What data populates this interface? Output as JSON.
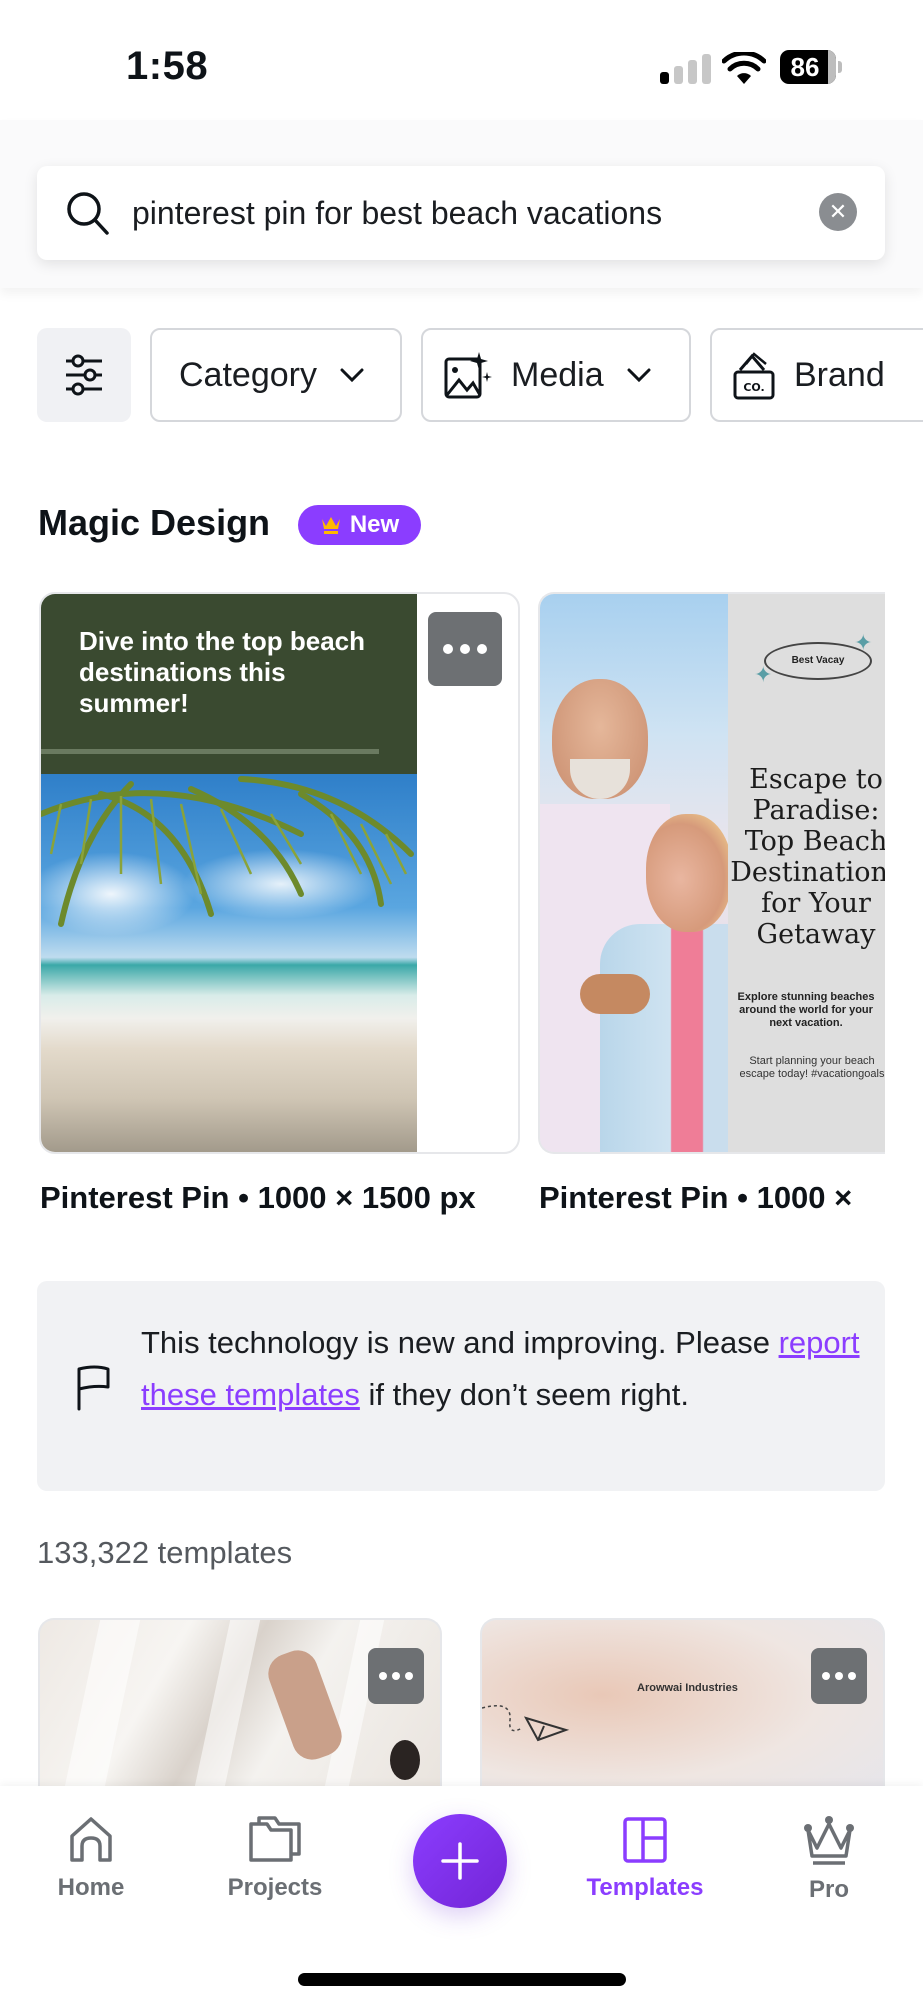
{
  "status_bar": {
    "time": "1:58",
    "battery": "86",
    "signal_bars_active": 1,
    "signal_bars_total": 4
  },
  "search": {
    "query": "pinterest pin for best beach vacations",
    "icon": "search-icon",
    "clear_icon": "clear-icon"
  },
  "filters": {
    "toggle_icon": "sliders-icon",
    "chips": [
      {
        "label": "Category",
        "icon": null,
        "has_chevron": true
      },
      {
        "label": "Media",
        "icon": "image-sparkle-icon",
        "has_chevron": true
      },
      {
        "label": "Brand",
        "icon": "brand-kit-icon",
        "has_chevron": false
      }
    ]
  },
  "magic_design": {
    "title": "Magic Design",
    "badge": "New",
    "badge_color": "#8b3dff",
    "cards": [
      {
        "headline": "Dive into the top beach destinations this summer!",
        "caption": "Pinterest Pin • 1000 × 1500 px"
      },
      {
        "badge_text": "Best Vacay",
        "title_lines": [
          "Escape to",
          "Paradise:",
          "Top Beach",
          "Destinations",
          "for Your",
          "Getaway"
        ],
        "subtitle": "Explore stunning beaches around the world for your next vacation.",
        "body": "Start planning your beach escape today! #vacationgoals",
        "caption": "Pinterest Pin • 1000 ×"
      }
    ]
  },
  "notice": {
    "text_before": "This technology is new and improving. Please ",
    "link": "report these templates",
    "text_after": " if they don’t seem right."
  },
  "results": {
    "count_label": "133,322 templates",
    "cards": [
      {
        "label": ""
      },
      {
        "label": "Arowwai Industries"
      }
    ]
  },
  "bottom_nav": {
    "items": [
      {
        "label": "Home",
        "icon": "home-icon",
        "active": false
      },
      {
        "label": "Projects",
        "icon": "folder-icon",
        "active": false
      },
      {
        "label": "Templates",
        "icon": "templates-icon",
        "active": true
      },
      {
        "label": "Pro",
        "icon": "crown-icon",
        "active": false
      }
    ],
    "create_button": "plus-icon"
  },
  "colors": {
    "accent": "#8b3dff",
    "text": "#0e1318",
    "muted": "#6b6f74"
  }
}
